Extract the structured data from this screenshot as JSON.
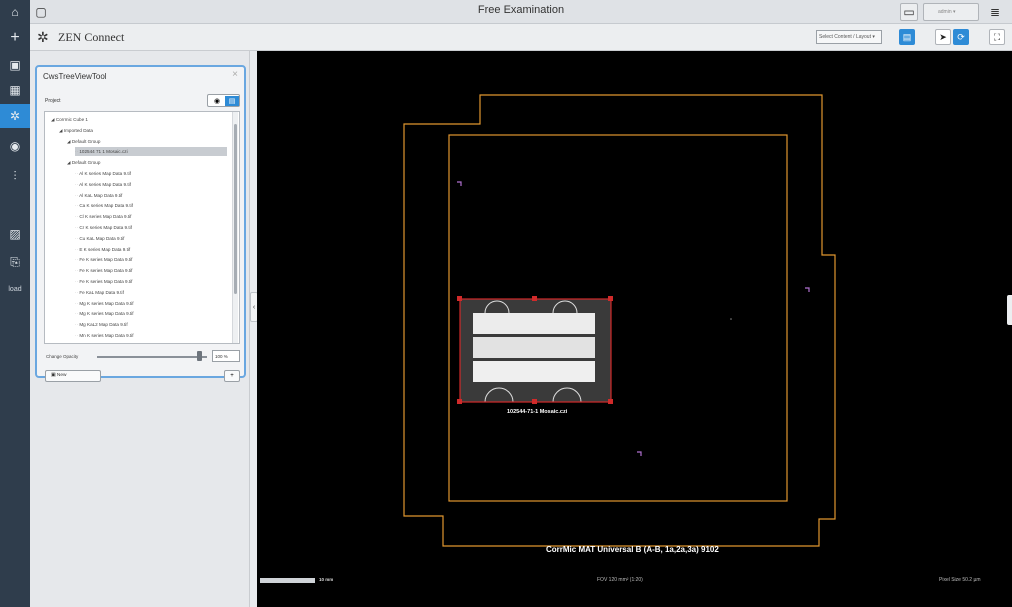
{
  "window": {
    "title": "Free Examination",
    "user_label": "admin"
  },
  "app": {
    "title": "ZEN Connect",
    "select_placeholder": "Select Content / Layout"
  },
  "sidebar": {
    "text_item": "load"
  },
  "tool": {
    "title": "CwsTreeViewTool",
    "project_label": "Project",
    "tree": [
      {
        "label": "Corrmic Cube 1",
        "indent": 0,
        "arrow": true
      },
      {
        "label": "Imported Data",
        "indent": 1,
        "arrow": true
      },
      {
        "label": "Default Group",
        "indent": 2,
        "arrow": true
      },
      {
        "label": "102544 71 1 Mosaic.czi",
        "indent": 3,
        "arrow": false,
        "selected": true
      },
      {
        "label": "Default Group",
        "indent": 2,
        "arrow": true
      },
      {
        "label": "Al K series Map Data 9.tif",
        "indent": 3,
        "arrow": false
      },
      {
        "label": "Al K series Map Data 9.tif",
        "indent": 3,
        "arrow": false
      },
      {
        "label": "Al KaL Map Data 9.tif",
        "indent": 3,
        "arrow": false
      },
      {
        "label": "Ca K series Map Data 9.tif",
        "indent": 3,
        "arrow": false
      },
      {
        "label": "Cl K series Map Data 9.tif",
        "indent": 3,
        "arrow": false
      },
      {
        "label": "Cr K series Map Data 9.tif",
        "indent": 3,
        "arrow": false
      },
      {
        "label": "Cu KaL Map Data 9.tif",
        "indent": 3,
        "arrow": false
      },
      {
        "label": "E K series Map Data 9.tif",
        "indent": 3,
        "arrow": false
      },
      {
        "label": "Fe K series Map Data 9.tif",
        "indent": 3,
        "arrow": false
      },
      {
        "label": "Fe K series Map Data 9.tif",
        "indent": 3,
        "arrow": false
      },
      {
        "label": "Fe K series Map Data 9.tif",
        "indent": 3,
        "arrow": false
      },
      {
        "label": "Fe KaL Map Data 9.tif",
        "indent": 3,
        "arrow": false
      },
      {
        "label": "Mg K series Map Data 9.tif",
        "indent": 3,
        "arrow": false
      },
      {
        "label": "Mg K series Map Data 9.tif",
        "indent": 3,
        "arrow": false
      },
      {
        "label": "Mg KaL2 Map Data 9.tif",
        "indent": 3,
        "arrow": false
      },
      {
        "label": "Mn K series Map Data 9.tif",
        "indent": 3,
        "arrow": false
      }
    ],
    "opacity_label": "Change Opacity",
    "opacity_value": "100 %",
    "opacity_fraction": 0.93,
    "new_button": "New",
    "add_button": "+"
  },
  "canvas": {
    "mosaic_label": "102544-71-1 Mosaic.czi",
    "sample_label": "CorrMic MAT Universal B (A-B, 1a,2a,3a) 9102",
    "scale_label": "10 mm",
    "fov_label": "FOV 120 mm² (1:20)",
    "pixel_label": "Pixel Size 50.2 µm"
  },
  "colors": {
    "rail": "#2f3d4c",
    "accent": "#2e8bd6",
    "outline": "#e0962f",
    "roi": "#d12a2a"
  }
}
